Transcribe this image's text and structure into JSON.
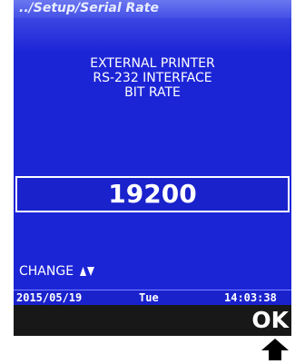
{
  "titlebar": {
    "path": "../Setup/Serial Rate"
  },
  "heading": {
    "line1": "EXTERNAL PRINTER",
    "line2": "RS-232 INTERFACE",
    "line3": "BIT RATE"
  },
  "value": {
    "text": "19200"
  },
  "change": {
    "label": "CHANGE",
    "icon": "up-down-arrows-icon"
  },
  "status": {
    "date": "2015/05/19",
    "day": "Tue",
    "time": "14:03:38"
  },
  "softkey": {
    "ok_label": "OK"
  },
  "colors": {
    "screen_bg": "#1c25d6",
    "titlebar": "#5561ec",
    "softkey_bar": "#181818"
  }
}
